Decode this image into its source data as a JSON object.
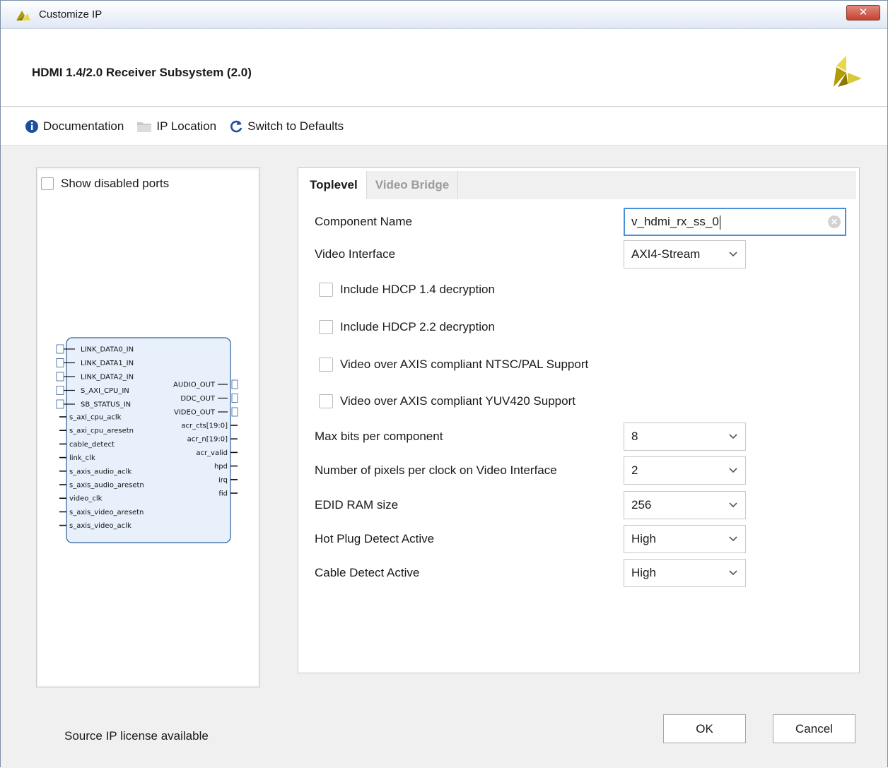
{
  "window": {
    "title": "Customize IP",
    "close_label": "✕"
  },
  "header": {
    "ip_title": "HDMI 1.4/2.0 Receiver Subsystem (2.0)"
  },
  "toolbar": {
    "documentation": "Documentation",
    "ip_location": "IP Location",
    "switch_defaults": "Switch to Defaults"
  },
  "symbol_panel": {
    "show_disabled_ports": "Show disabled ports",
    "left_bus_ports": [
      "LINK_DATA0_IN",
      "LINK_DATA1_IN",
      "LINK_DATA2_IN",
      "S_AXI_CPU_IN",
      "SB_STATUS_IN"
    ],
    "left_ports": [
      "s_axi_cpu_aclk",
      "s_axi_cpu_aresetn",
      "cable_detect",
      "link_clk",
      "s_axis_audio_aclk",
      "s_axis_audio_aresetn",
      "video_clk",
      "s_axis_video_aresetn",
      "s_axis_video_aclk"
    ],
    "right_bus_ports": [
      "AUDIO_OUT",
      "DDC_OUT",
      "VIDEO_OUT"
    ],
    "right_ports": [
      "acr_cts[19:0]",
      "acr_n[19:0]",
      "acr_valid",
      "hpd",
      "irq",
      "fid"
    ]
  },
  "license": "Source IP license available",
  "tabs": [
    {
      "label": "Toplevel",
      "active": true
    },
    {
      "label": "Video Bridge",
      "active": false
    }
  ],
  "form": {
    "component_name_label": "Component Name",
    "component_name_value": "v_hdmi_rx_ss_0",
    "video_interface_label": "Video Interface",
    "video_interface_value": "AXI4-Stream",
    "checkboxes": [
      {
        "label": "Include HDCP 1.4 decryption",
        "checked": false
      },
      {
        "label": "Include HDCP 2.2 decryption",
        "checked": false
      },
      {
        "label": "Video over AXIS compliant NTSC/PAL Support",
        "checked": false
      },
      {
        "label": "Video over AXIS compliant YUV420 Support",
        "checked": false
      }
    ],
    "max_bits_label": "Max bits per component",
    "max_bits_value": "8",
    "pixels_per_clock_label": "Number of pixels per clock on Video Interface",
    "pixels_per_clock_value": "2",
    "edid_label": "EDID RAM size",
    "edid_value": "256",
    "hpd_label": "Hot Plug Detect Active",
    "hpd_value": "High",
    "cable_label": "Cable Detect Active",
    "cable_value": "High"
  },
  "buttons": {
    "ok": "OK",
    "cancel": "Cancel"
  },
  "colors": {
    "accent": "#4a90d9",
    "logo_dark": "#b29a00",
    "logo_light": "#e8d94a",
    "info_blue": "#1f4e9c"
  }
}
